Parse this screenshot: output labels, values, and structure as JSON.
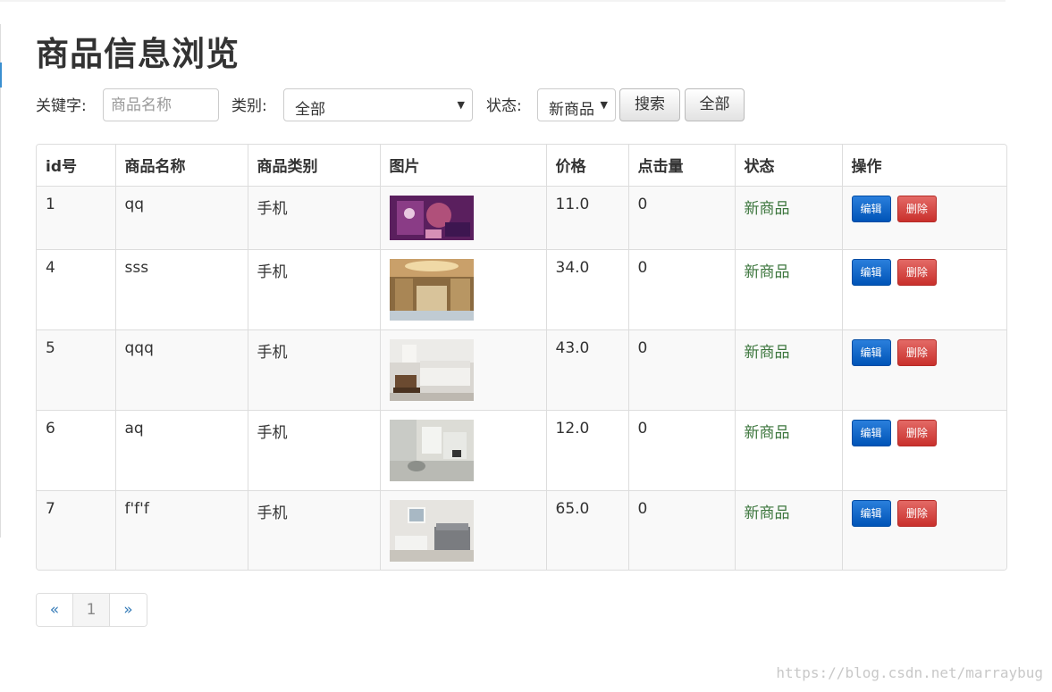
{
  "page": {
    "title": "商品信息浏览"
  },
  "search": {
    "keyword_label": "关键字:",
    "keyword_placeholder": "商品名称",
    "category_label": "类别:",
    "category_selected": "全部",
    "status_label": "状态:",
    "status_selected": "新商品",
    "search_button": "搜索",
    "all_button": "全部"
  },
  "table": {
    "headers": [
      "id号",
      "商品名称",
      "商品类别",
      "图片",
      "价格",
      "点击量",
      "状态",
      "操作"
    ],
    "rows": [
      {
        "id": "1",
        "name": "qq",
        "category": "手机",
        "image": "purple-artwork",
        "price": "11.0",
        "clicks": "0",
        "status": "新商品"
      },
      {
        "id": "4",
        "name": "sss",
        "category": "手机",
        "image": "hotel-lobby",
        "price": "34.0",
        "clicks": "0",
        "status": "新商品"
      },
      {
        "id": "5",
        "name": "qqq",
        "category": "手机",
        "image": "living-room-sofa",
        "price": "43.0",
        "clicks": "0",
        "status": "新商品"
      },
      {
        "id": "6",
        "name": "aq",
        "category": "手机",
        "image": "bright-living-room",
        "price": "12.0",
        "clicks": "0",
        "status": "新商品"
      },
      {
        "id": "7",
        "name": "f'f'f",
        "category": "手机",
        "image": "bedroom-sofa",
        "price": "65.0",
        "clicks": "0",
        "status": "新商品"
      }
    ],
    "edit_label": "编辑",
    "delete_label": "删除"
  },
  "pagination": {
    "prev": "«",
    "current": "1",
    "next": "»"
  },
  "watermark": "https://blog.csdn.net/marraybug",
  "colors": {
    "status_green": "#3c763d",
    "link_blue": "#337ab7",
    "edit_blue": "#0054b7",
    "delete_red": "#c9302c"
  }
}
